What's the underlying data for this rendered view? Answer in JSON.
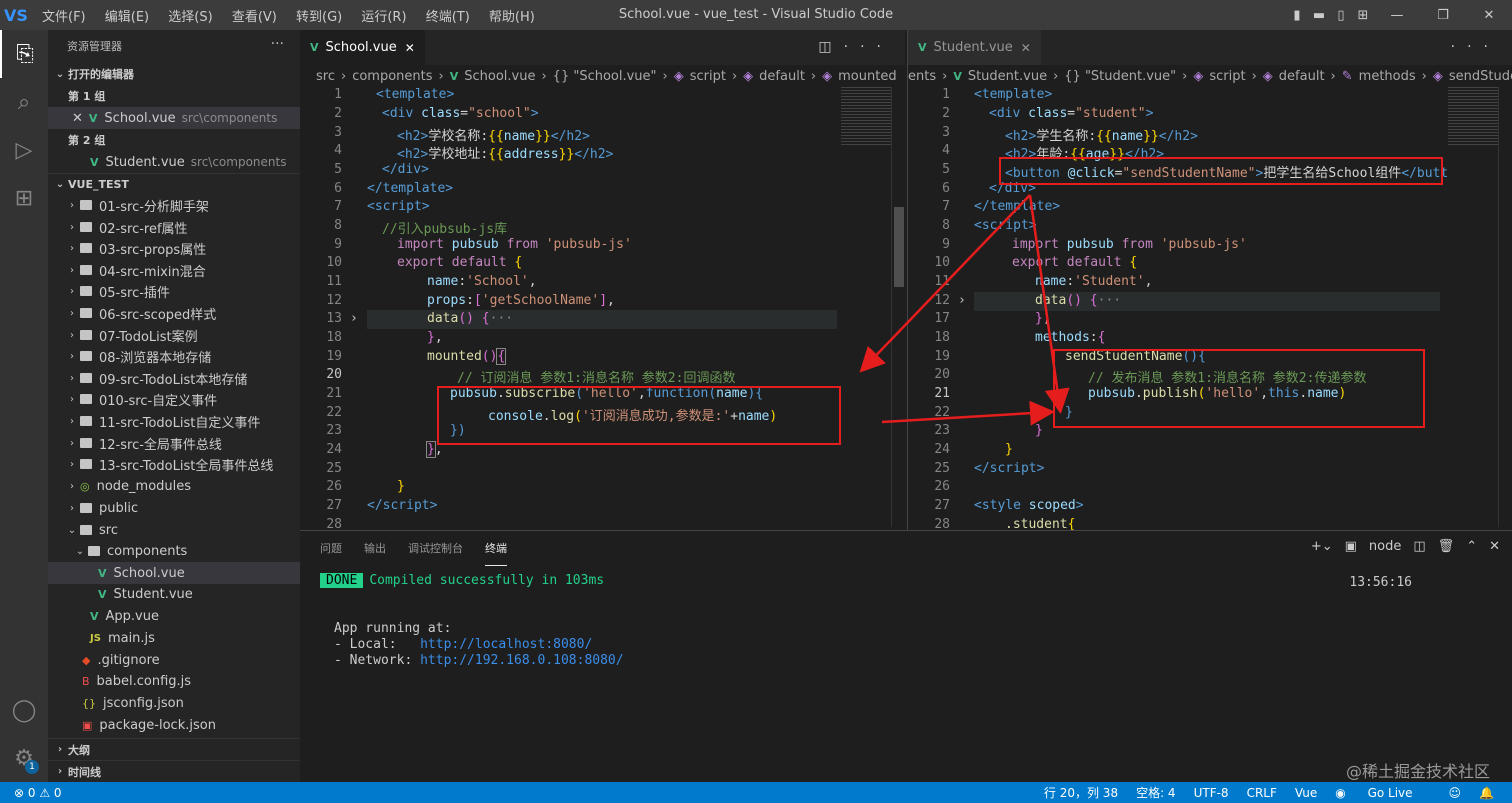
{
  "titlebar": {
    "logo": "VS",
    "menu": [
      "文件(F)",
      "编辑(E)",
      "选择(S)",
      "查看(V)",
      "转到(G)",
      "运行(R)",
      "终端(T)",
      "帮助(H)"
    ],
    "title": "School.vue - vue_test - Visual Studio Code"
  },
  "sidebar": {
    "header": "资源管理器",
    "open_editors": "打开的编辑器",
    "group1": "第 1 组",
    "group2": "第 2 组",
    "open1": {
      "name": "School.vue",
      "path": "src\\components"
    },
    "open2": {
      "name": "Student.vue",
      "path": "src\\components"
    },
    "project": "VUE_TEST",
    "folders": [
      "01-src-分析脚手架",
      "02-src-ref属性",
      "03-src-props属性",
      "04-src-mixin混合",
      "05-src-插件",
      "06-src-scoped样式",
      "07-TodoList案例",
      "08-浏览器本地存储",
      "09-src-TodoList本地存储",
      "010-src-自定义事件",
      "11-src-TodoList自定义事件",
      "12-src-全局事件总线",
      "13-src-TodoList全局事件总线",
      "node_modules",
      "public",
      "src"
    ],
    "components": "components",
    "school": "School.vue",
    "student": "Student.vue",
    "app": "App.vue",
    "main": "main.js",
    "files": [
      ".gitignore",
      "babel.config.js",
      "jsconfig.json",
      "package-lock.json"
    ],
    "outline": "大纲",
    "timeline": "时间线"
  },
  "left_editor": {
    "tab": "School.vue",
    "breadcrumb": [
      "src",
      "components",
      "School.vue",
      "{} \"School.vue\"",
      "script",
      "default",
      "mounted"
    ],
    "lines": [
      "1",
      "2",
      "3",
      "4",
      "5",
      "6",
      "7",
      "8",
      "9",
      "10",
      "11",
      "12",
      "13",
      "18",
      "19",
      "20",
      "21",
      "22",
      "23",
      "24",
      "25",
      "26",
      "27",
      "28"
    ]
  },
  "right_editor": {
    "tab": "Student.vue",
    "breadcrumb": [
      "ents",
      "Student.vue",
      "{} \"Student.vue\"",
      "script",
      "default",
      "methods",
      "sendStudentName"
    ],
    "lines": [
      "1",
      "2",
      "3",
      "4",
      "5",
      "6",
      "7",
      "8",
      "9",
      "10",
      "11",
      "12",
      "17",
      "18",
      "19",
      "20",
      "21",
      "22",
      "23",
      "24",
      "25",
      "26",
      "27",
      "28"
    ]
  },
  "panel": {
    "tabs": [
      "问题",
      "输出",
      "调试控制台",
      "终端"
    ],
    "terminal_name": "node",
    "done": "DONE",
    "compiled": "Compiled successfully in 103ms",
    "time": "13:56:16",
    "running": "App running at:",
    "local_label": "- Local:   ",
    "local_url": "http://localhost:8080/",
    "network_label": "- Network: ",
    "network_url": "http://192.168.0.108:8080/"
  },
  "status": {
    "errors": "⊗ 0 ⚠ 0",
    "position": "行 20，列 38",
    "spaces": "空格: 4",
    "encoding": "UTF-8",
    "eol": "CRLF",
    "lang": "Vue",
    "golive": "Go Live"
  },
  "watermark": "@稀土掘金技术社区"
}
